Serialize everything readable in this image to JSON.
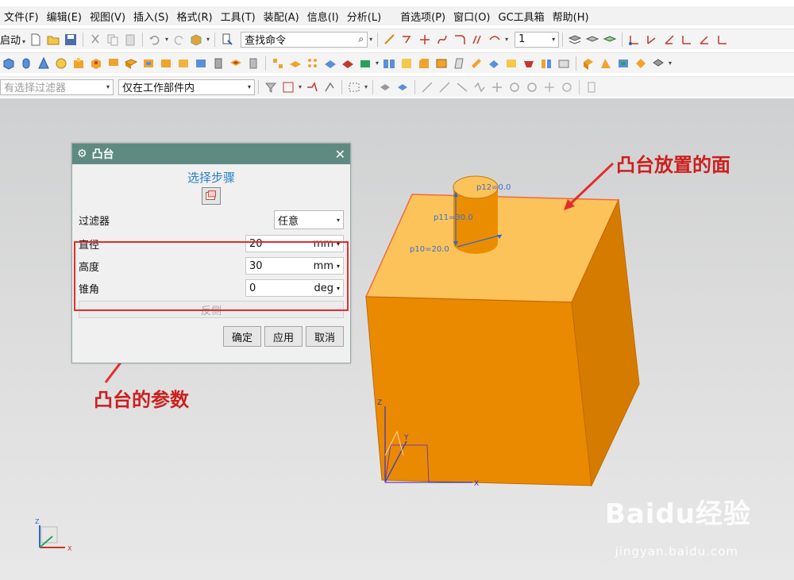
{
  "menu": {
    "items": [
      "文件(F)",
      "编辑(E)",
      "视图(V)",
      "插入(S)",
      "格式(R)",
      "工具(T)",
      "装配(A)",
      "信息(I)",
      "分析(L)",
      "首选项(P)",
      "窗口(O)",
      "GC工具箱",
      "帮助(H)"
    ]
  },
  "toolbar": {
    "start_label": "启动",
    "find_command_value": "查找命令",
    "count_value": "1",
    "filter_placeholder": "有选择过滤器",
    "scope_value": "仅在工作部件内"
  },
  "dialog": {
    "title": "凸台",
    "select_step_label": "选择步骤",
    "filter_label": "过滤器",
    "filter_value": "任意",
    "params": [
      {
        "label": "直径",
        "value": "20",
        "unit": "mm"
      },
      {
        "label": "高度",
        "value": "30",
        "unit": "mm"
      },
      {
        "label": "锥角",
        "value": "0",
        "unit": "deg"
      }
    ],
    "reverse_side_label": "反侧",
    "ok_label": "确定",
    "apply_label": "应用",
    "cancel_label": "取消"
  },
  "scene": {
    "dim_p12": "p12=0.0",
    "dim_p11": "p11=30.0",
    "dim_p10": "p10=20.0",
    "axis_x": "X",
    "axis_y": "Y",
    "axis_z": "Z",
    "face_color": "#fbc35a",
    "front_color": "#ea8a00",
    "side_color": "#d57c00"
  },
  "annotations": {
    "placement_face": "凸台放置的面",
    "params": "凸台的参数",
    "color": "#cc1f1f"
  },
  "watermark": {
    "brand": "Baidu经验",
    "url": "jingyan.baidu.com"
  }
}
